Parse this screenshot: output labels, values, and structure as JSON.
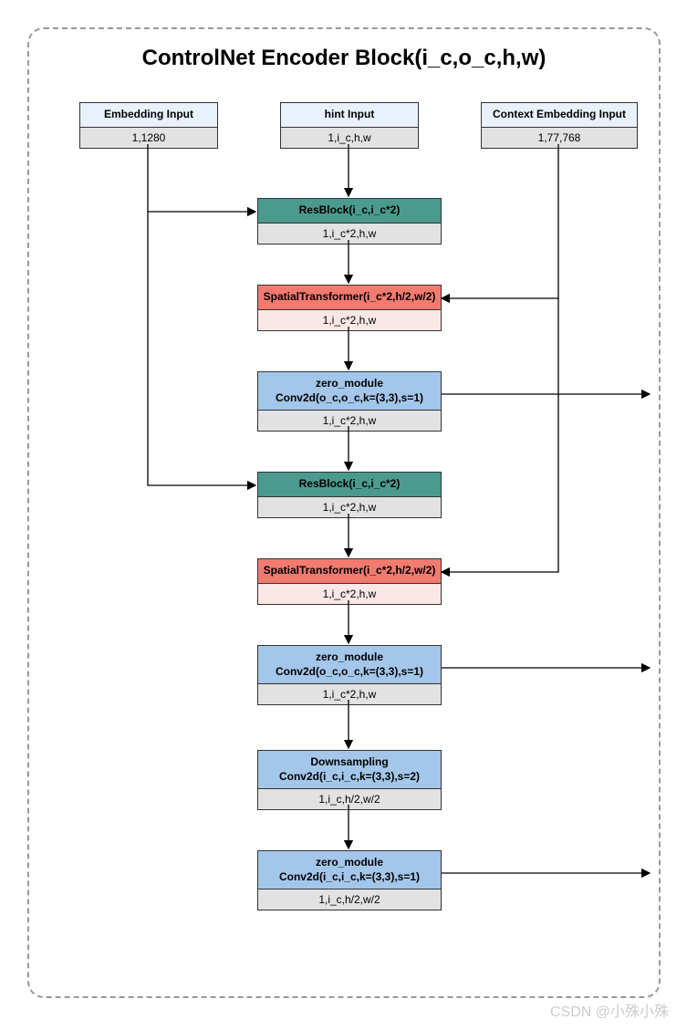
{
  "title": "ControlNet Encoder Block(i_c,o_c,h,w)",
  "watermark": "CSDN @小殊小殊",
  "inputs": {
    "embedding": {
      "label": "Embedding Input",
      "shape": "1,1280"
    },
    "hint": {
      "label": "hint Input",
      "shape": "1,i_c,h,w"
    },
    "context": {
      "label": "Context Embedding Input",
      "shape": "1,77,768"
    }
  },
  "blocks": {
    "res1": {
      "label": "ResBlock(i_c,i_c*2)",
      "shape": "1,i_c*2,h,w"
    },
    "st1": {
      "label": "SpatialTransformer(i_c*2,h/2,w/2)",
      "shape": "1,i_c*2,h,w"
    },
    "zm1": {
      "label1": "zero_module",
      "label2": "Conv2d(o_c,o_c,k=(3,3),s=1)",
      "shape": "1,i_c*2,h,w"
    },
    "res2": {
      "label": "ResBlock(i_c,i_c*2)",
      "shape": "1,i_c*2,h,w"
    },
    "st2": {
      "label": "SpatialTransformer(i_c*2,h/2,w/2)",
      "shape": "1,i_c*2,h,w"
    },
    "zm2": {
      "label1": "zero_module",
      "label2": "Conv2d(o_c,o_c,k=(3,3),s=1)",
      "shape": "1,i_c*2,h,w"
    },
    "down": {
      "label1": "Downsampling",
      "label2": "Conv2d(i_c,i_c,k=(3,3),s=2)",
      "shape": "1,i_c,h/2,w/2"
    },
    "zm3": {
      "label1": "zero_module",
      "label2": "Conv2d(i_c,i_c,k=(3,3),s=1)",
      "shape": "1,i_c,h/2,w/2"
    }
  }
}
